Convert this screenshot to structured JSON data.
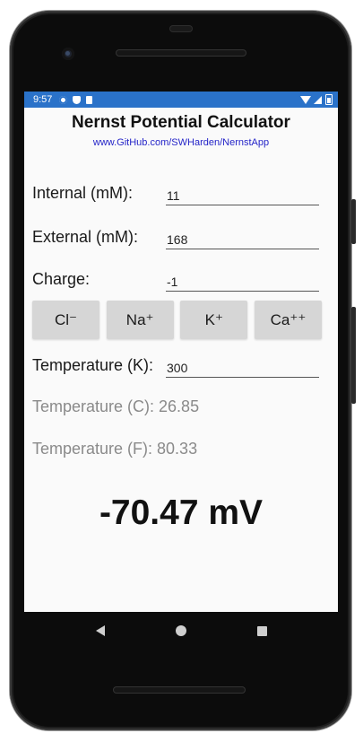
{
  "status_bar": {
    "time": "9:57",
    "left_icons": [
      "gear-icon",
      "shield-icon",
      "sd-card-icon"
    ],
    "right_icons": [
      "wifi-icon",
      "cell-signal-icon",
      "battery-icon"
    ],
    "color": "#2a72c9"
  },
  "app": {
    "title": "Nernst Potential Calculator",
    "link": "www.GitHub.com/SWHarden/NernstApp"
  },
  "form": {
    "internal": {
      "label": "Internal (mM):",
      "value": "11"
    },
    "external": {
      "label": "External (mM):",
      "value": "168"
    },
    "charge": {
      "label": "Charge:",
      "value": "-1"
    },
    "temperature_k": {
      "label": "Temperature (K):",
      "value": "300"
    }
  },
  "ion_buttons": [
    {
      "label": "Cl⁻"
    },
    {
      "label": "Na⁺"
    },
    {
      "label": "K⁺"
    },
    {
      "label": "Ca⁺⁺"
    }
  ],
  "readouts": {
    "temperature_c": "Temperature (C): 26.85",
    "temperature_f": "Temperature (F): 80.33"
  },
  "result": "-70.47 mV",
  "nav_bar": [
    "back-icon",
    "home-icon",
    "recents-icon"
  ]
}
